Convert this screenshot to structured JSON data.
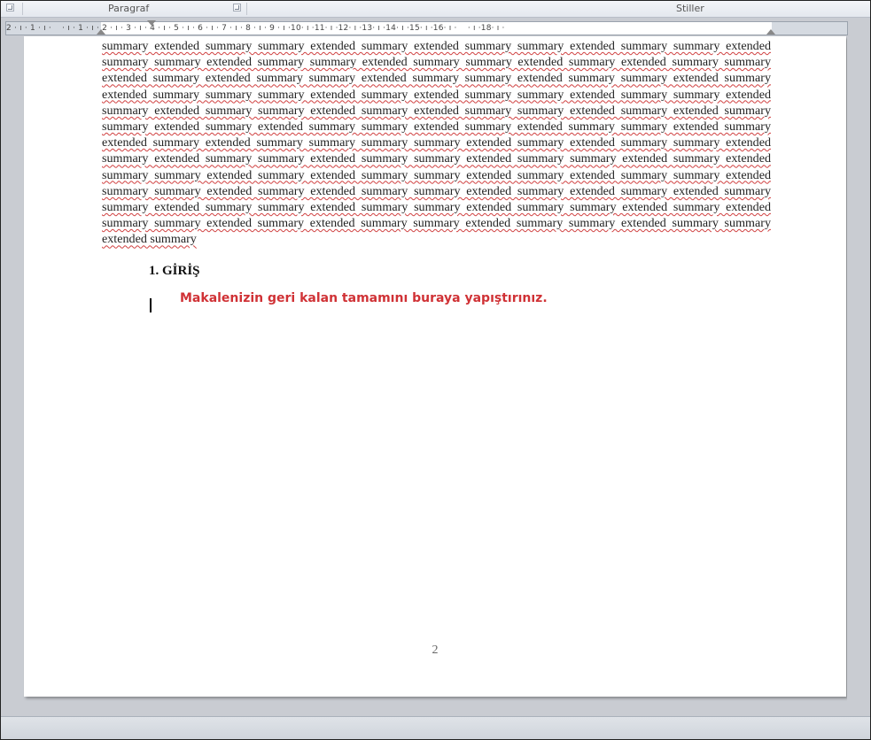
{
  "ribbon": {
    "paragraph_group_label": "Paragraf",
    "styles_group_label": "Stiller"
  },
  "ruler": {
    "ticks": "2 · ı · 1 · ı ·    · ı · 1 · ı · 2 · ı · 3 · ı · 4 · ı · 5 · ı · 6 · ı · 7 · ı · 8 · ı · 9 · ı ·10· ı ·11· ı ·12· ı ·13· ı ·14· ı ·15· ı ·16· ı ·    · ı ·18· ı ·"
  },
  "document": {
    "summary_text": "summary extended summary summary extended summary extended summary summary extended summary summary extended summary summary extended summary summary extended summary summary extended summary extended summary summary extended summary extended summary summary extended summary summary extended summary summary extended summary extended summary summary summary extended summary extended summary summary extended summary summary extended summary extended summary summary extended summary extended summary summary extended summary extended summary summary extended summary extended summary summary extended summary extended summary summary extended summary extended summary extended summary summary summary summary extended summary extended summary summary extended summary extended summary summary extended summary summary extended summary summary extended summary extended summary summary extended summary extended summary summary extended summary extended summary summary extended summary summary extended summary extended summary summary extended summary extended summary extended summary summary extended summary summary extended summary summary extended summary summary extended summary extended summary summary extended summary extended summary summary extended summary summary extended summary summary extended summary",
    "heading": "1. GİRİŞ",
    "instruction": "Makalenizin geri kalan tamamını buraya yapıştırınız.",
    "page_number": "2"
  },
  "colors": {
    "instruction": "#d03236",
    "spellcheck_underline": "#d04040"
  }
}
